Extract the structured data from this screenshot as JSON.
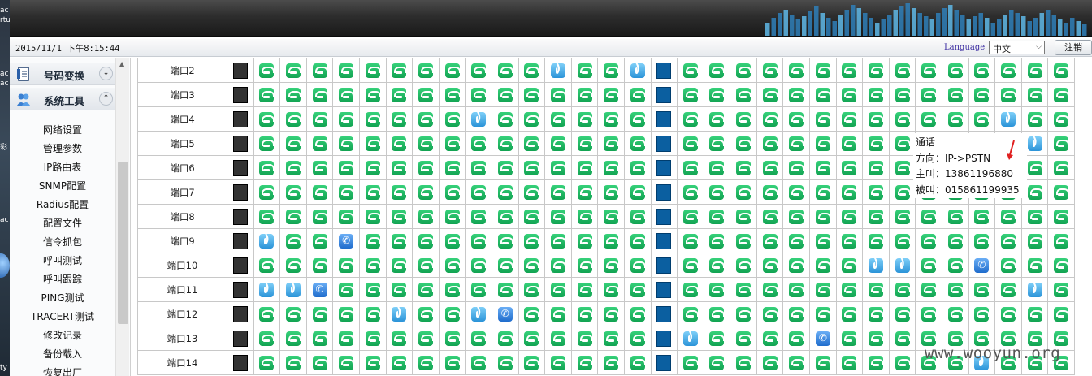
{
  "header": {
    "datetime": "2015/11/1 下午8:15:44",
    "language_label": "Language",
    "language_value": "中文",
    "logout_label": "注销"
  },
  "sidebar": {
    "sections": [
      {
        "label": "号码变换",
        "icon": "document-icon",
        "state": "collapsed"
      },
      {
        "label": "系统工具",
        "icon": "users-icon",
        "state": "expanded"
      }
    ],
    "items": [
      "网络设置",
      "管理参数",
      "IP路由表",
      "SNMP配置",
      "Radius配置",
      "配置文件",
      "信令抓包",
      "呼叫测试",
      "呼叫跟踪",
      "PING测试",
      "TRACERT测试",
      "修改记录",
      "备份载入",
      "恢复出厂"
    ]
  },
  "ports": {
    "rows": [
      {
        "label": "端口2",
        "talk": [
          12,
          15
        ]
      },
      {
        "label": "端口3",
        "talk": []
      },
      {
        "label": "端口4",
        "talk": [
          9,
          29
        ],
        "ring": []
      },
      {
        "label": "端口5",
        "talk": [
          30
        ]
      },
      {
        "label": "端口6",
        "talk": []
      },
      {
        "label": "端口7",
        "talk": []
      },
      {
        "label": "端口8",
        "talk": []
      },
      {
        "label": "端口9",
        "talk": [
          1
        ],
        "ring": [
          4
        ]
      },
      {
        "label": "端口10",
        "talk": [
          24,
          25
        ],
        "ring": [
          28
        ]
      },
      {
        "label": "端口11",
        "talk": [
          1,
          2,
          30
        ],
        "ring": [
          3
        ]
      },
      {
        "label": "端口12",
        "talk": [
          6,
          9
        ],
        "ring": [
          10
        ]
      },
      {
        "label": "端口13",
        "talk": [
          17
        ],
        "ring": [
          22
        ]
      },
      {
        "label": "端口14",
        "talk": [
          28
        ]
      }
    ],
    "block_columns": {
      "black": 0,
      "blue": 16
    },
    "columns": 32
  },
  "tooltip": {
    "line1": "通话",
    "line2": "方向：IP->PSTN",
    "line3": "主叫：13861196880",
    "line4": "被叫：015861199935"
  },
  "watermark": "www.wooyun.org",
  "desktop_fragments": [
    "ac",
    "rtu",
    "ac",
    "ac",
    "彩",
    "ac",
    "ty"
  ],
  "colors": {
    "idle": "#12a352",
    "talk": "#2b93d8",
    "ring": "#1f6ccc",
    "blocked_black": "#333333",
    "blocked_blue": "#0b5fa0",
    "tooltip_arrow": "#e02020"
  }
}
